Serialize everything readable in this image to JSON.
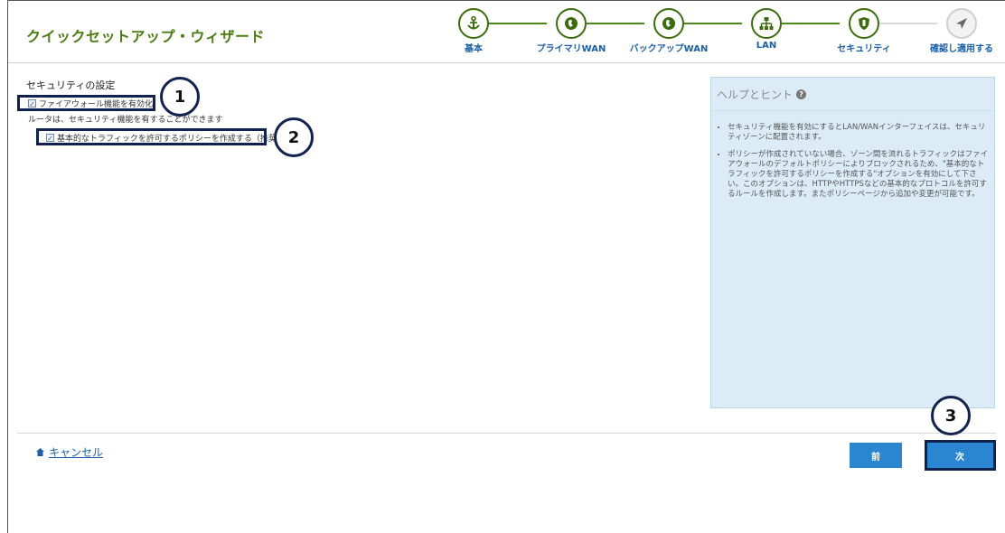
{
  "header": {
    "title": "クイックセットアップ・ウィザード"
  },
  "steps": [
    {
      "label": "基本",
      "icon": "anchor-icon",
      "state": "done"
    },
    {
      "label": "プライマリWAN",
      "icon": "globe-icon",
      "state": "done"
    },
    {
      "label": "バックアップWAN",
      "icon": "globe-icon",
      "state": "done"
    },
    {
      "label": "LAN",
      "icon": "network-icon",
      "state": "done"
    },
    {
      "label": "セキュリティ",
      "icon": "shield-icon",
      "state": "current"
    },
    {
      "label": "確認し適用する",
      "icon": "send-icon",
      "state": "pending"
    }
  ],
  "security": {
    "section_title": "セキュリティの設定",
    "firewall_label": "ファイアウォール機能を有効化",
    "firewall_checked": true,
    "note": "ルータは、セキュリティ機能を有することができます",
    "policy_label": "基本的なトラフィックを許可するポリシーを作成する（推奨）",
    "policy_checked": true
  },
  "help": {
    "title": "ヘルプとヒント",
    "items": [
      "セキュリティ機能を有効にするとLAN/WANインターフェイスは、セキュリティゾーンに配置されます。",
      "ポリシーが作成されていない場合、ゾーン間を流れるトラフィックはファイアウォールのデフォルトポリシーによりブロックされるため、\"基本的なトラフィックを許可するポリシーを作成する\"オプションを有効にして下さい。このオプションは、HTTPやHTTPSなどの基本的なプロトコルを許可するルールを作成します。またポリシーページから追加や変更が可能です。"
    ]
  },
  "footer": {
    "cancel_label": "キャンセル",
    "prev_label": "前",
    "next_label": "次"
  },
  "annotations": [
    "1",
    "2",
    "3"
  ],
  "colors": {
    "accent_green": "#3a6d0c",
    "button_blue": "#2b86d2",
    "annotation_navy": "#10224f",
    "help_bg": "#dcecf6"
  }
}
